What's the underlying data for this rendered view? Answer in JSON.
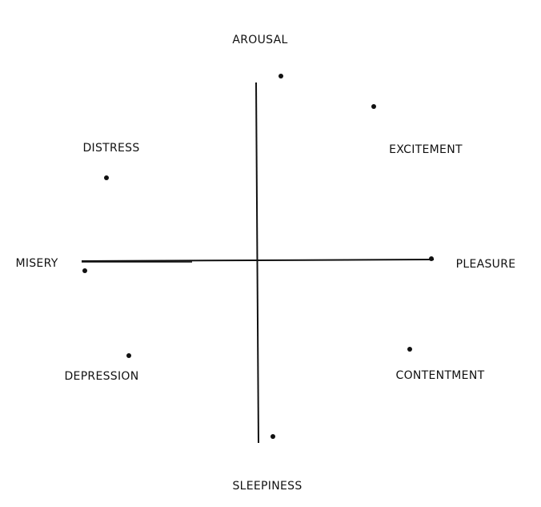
{
  "labels": {
    "arousal": "AROUSAL",
    "excitement": "EXCITEMENT",
    "pleasure": "PLEASURE",
    "contentment": "CONTENTMENT",
    "sleepiness": "SLEEPINESS",
    "depression": "DEPRESSION",
    "misery": "MISERY",
    "distress": "DISTRESS"
  }
}
